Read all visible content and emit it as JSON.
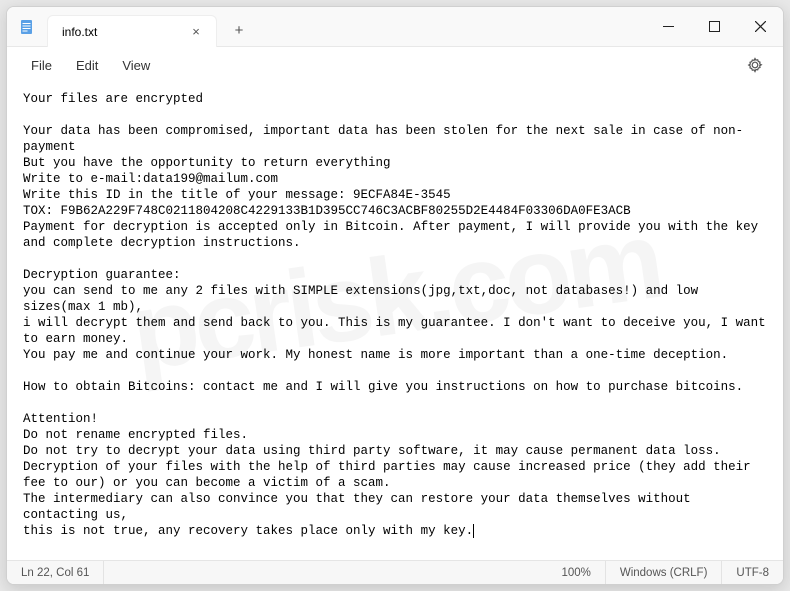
{
  "app": {
    "icon": "notepad-icon"
  },
  "tabs": [
    {
      "title": "info.txt",
      "close_label": "×"
    }
  ],
  "newtab_label": "+",
  "window_controls": {
    "minimize": "–",
    "maximize": "▢",
    "close": "✕"
  },
  "menus": {
    "file": "File",
    "edit": "Edit",
    "view": "View"
  },
  "content": "Your files are encrypted\n\nYour data has been compromised, important data has been stolen for the next sale in case of non-payment\nBut you have the opportunity to return everything\nWrite to e-mail:data199@mailum.com\nWrite this ID in the title of your message: 9ECFA84E-3545\nTOX: F9B62A229F748C0211804208C4229133B1D395CC746C3ACBF80255D2E4484F03306DA0FE3ACB\nPayment for decryption is accepted only in Bitcoin. After payment, I will provide you with the key and complete decryption instructions.\n\nDecryption guarantee:\nyou can send to me any 2 files with SIMPLE extensions(jpg,txt,doc, not databases!) and low sizes(max 1 mb),\ni will decrypt them and send back to you. This is my guarantee. I don't want to deceive you, I want to earn money.\nYou pay me and continue your work. My honest name is more important than a one-time deception.\n\nHow to obtain Bitcoins: contact me and I will give you instructions on how to purchase bitcoins.\n\nAttention!\nDo not rename encrypted files.\nDo not try to decrypt your data using third party software, it may cause permanent data loss.\nDecryption of your files with the help of third parties may cause increased price (they add their fee to our) or you can become a victim of a scam.\nThe intermediary can also convince you that they can restore your data themselves without contacting us,\nthis is not true, any recovery takes place only with my key.",
  "status": {
    "position": "Ln 22, Col 61",
    "zoom": "100%",
    "line_ending": "Windows (CRLF)",
    "encoding": "UTF-8"
  },
  "watermark": "pcrisk.com"
}
